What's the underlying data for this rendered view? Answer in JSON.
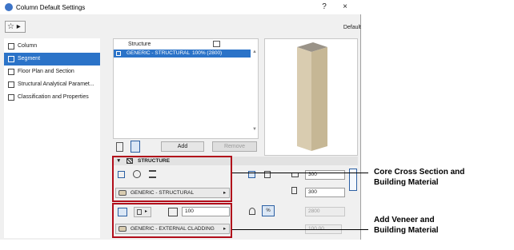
{
  "window": {
    "title": "Column Default Settings",
    "help": "?",
    "close": "×"
  },
  "toolbar": {
    "favorites": "☆ ▸",
    "default_label": "Default"
  },
  "sidebar": {
    "items": [
      {
        "label": "Column",
        "selected": false
      },
      {
        "label": "Segment",
        "selected": true
      },
      {
        "label": "Floor Plan and Section",
        "selected": false
      },
      {
        "label": "Structural Analytical Paramet...",
        "selected": false
      },
      {
        "label": "Classification and Properties",
        "selected": false
      }
    ]
  },
  "segment_list": {
    "header": "Structure",
    "row_material": "GENERIC - STRUCTURAL",
    "row_value": "100% (2800)"
  },
  "list_buttons": {
    "add": "Add",
    "remove": "Remove"
  },
  "structure_section": {
    "title": "STRUCTURE"
  },
  "core": {
    "material": "GENERIC - STRUCTURAL"
  },
  "dimensions": {
    "width": "300",
    "depth": "300",
    "height": "2800",
    "percent_icon": "%",
    "pct_disabled": "100.00"
  },
  "veneer": {
    "thickness": "100",
    "material": "GENERIC - EXTERNAL CLADDING"
  },
  "callouts": {
    "core_line1": "Core Cross Section and",
    "core_line2": "Building Material",
    "veneer_line1": "Add Veneer and",
    "veneer_line2": "Building Material"
  },
  "colors": {
    "accent": "#2b73c8",
    "callout_border": "#b10d1a"
  }
}
